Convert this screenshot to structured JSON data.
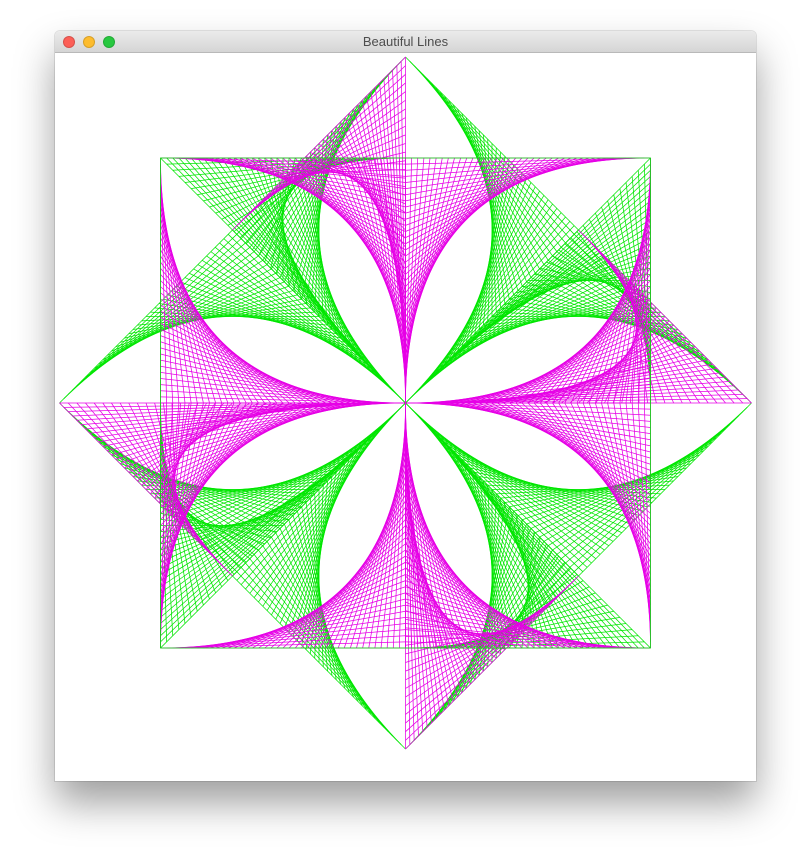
{
  "window": {
    "title": "Beautiful Lines"
  },
  "traffic_lights": {
    "close": "#fc5f57",
    "minimize": "#fdbc2e",
    "zoom": "#28c840"
  },
  "drawing": {
    "color_green": "#00e600",
    "color_magenta": "#e600e6",
    "strings_per_curve": 40
  }
}
